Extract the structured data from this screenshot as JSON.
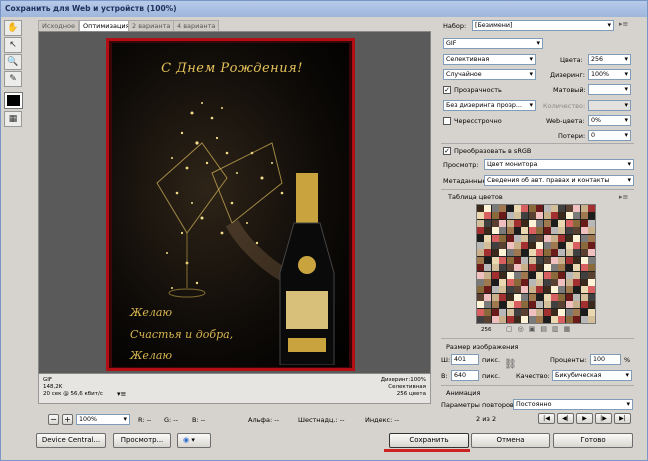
{
  "window": {
    "title": "Сохранить для Web и устройств (100%)"
  },
  "tabs": [
    "Исходное",
    "Оптимизация",
    "2 варианта",
    "4 варианта"
  ],
  "active_tab": 1,
  "image": {
    "greeting": "С Днем Рождения!",
    "wish_line1": "Желаю",
    "wish_line2": "Счастья и добра,",
    "wish_line3": "Желаю"
  },
  "status": {
    "format": "GIF",
    "size": "148,2K",
    "time": "20 сек @ 56,6 кбит/с",
    "dither": "Дизеринг:100%",
    "palette": "Селективная",
    "colors": "256 цвета"
  },
  "zoom": {
    "value": "100%",
    "r": "R: --",
    "g": "G: --",
    "b": "B: --",
    "alpha": "Альфа: --",
    "hex": "Шестнадц.: --",
    "index": "Индекс: --"
  },
  "buttons": {
    "device_central": "Device Central...",
    "preview": "Просмотр...",
    "save": "Сохранить",
    "cancel": "Отмена",
    "done": "Готово"
  },
  "settings": {
    "preset_label": "Набор:",
    "preset_value": "[Безимени]",
    "format_value": "GIF",
    "reduction_value": "Селективная",
    "colors_label": "Цвета:",
    "colors_value": "256",
    "dither_algo": "Случайное",
    "dither_label": "Дизеринг:",
    "dither_value": "100%",
    "transparency_label": "Прозрачность",
    "transparency_checked": "✓",
    "matte_label": "Матовый:",
    "transp_dither": "Без дизеринга прозр...",
    "amount_label": "Количество:",
    "interlaced_label": "Чересстрочно",
    "websnap_label": "Web-цвета:",
    "websnap_value": "0%",
    "lossy_label": "Потери:",
    "lossy_value": "0",
    "srgb_label": "Преобразовать в sRGB",
    "srgb_checked": "✓",
    "preview_label": "Просмотр:",
    "preview_value": "Цвет монитора",
    "metadata_label": "Метаданные:",
    "metadata_value": "Сведения об авт. правах и контакты"
  },
  "color_table": {
    "title": "Таблица цветов",
    "count": "256"
  },
  "image_size": {
    "title": "Размер изображения",
    "w_label": "Ш:",
    "w_value": "401",
    "h_label": "В:",
    "h_value": "640",
    "unit": "пикс.",
    "percent_label": "Проценты:",
    "percent_value": "100",
    "percent_unit": "%",
    "quality_label": "Качество:",
    "quality_value": "Бикубическая"
  },
  "animation": {
    "title": "Анимация",
    "loop_label": "Параметры повторов:",
    "loop_value": "Постоянно",
    "frame": "2 из 2"
  },
  "colors": {
    "accent_underline": "#cc2222",
    "card_border": "#b30e14",
    "gold": "#e6c35a"
  },
  "swatches": [
    "#3b2a1c",
    "#8a6a3a",
    "#c7b08a",
    "#e9d8b0",
    "#5a4030",
    "#a07850",
    "#d3c09a",
    "#fff4d8",
    "#6b1a1a",
    "#a33030",
    "#d86060",
    "#f0c0c0",
    "#1c1c1c",
    "#404040",
    "#7a7a7a",
    "#b8b8b8"
  ]
}
